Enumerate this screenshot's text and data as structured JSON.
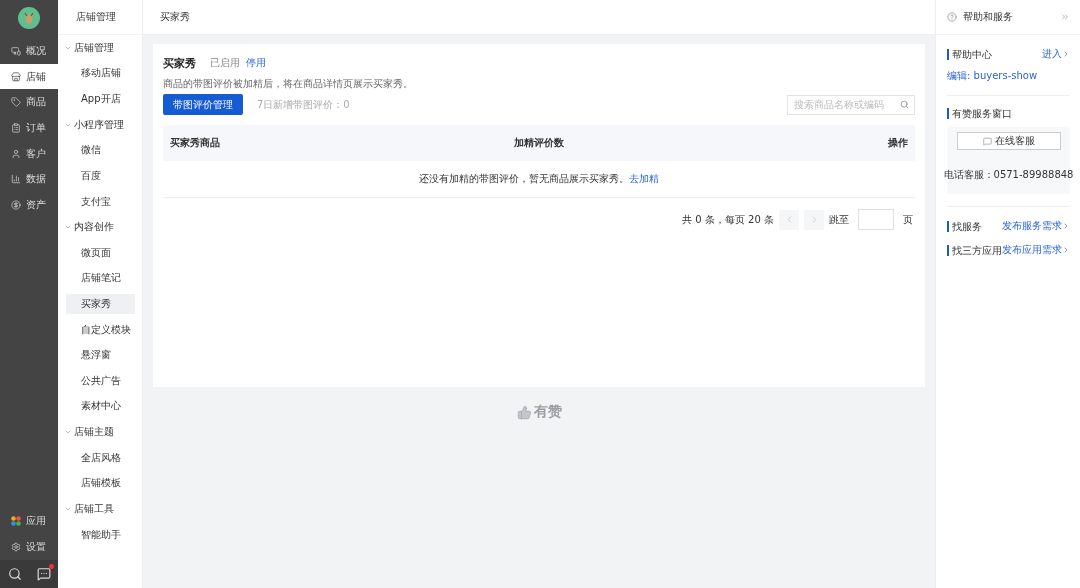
{
  "nav": {
    "top": [
      {
        "label": "概况",
        "selected": false
      },
      {
        "label": "店铺",
        "selected": true
      },
      {
        "label": "商品",
        "selected": false
      },
      {
        "label": "订单",
        "selected": false
      },
      {
        "label": "客户",
        "selected": false
      },
      {
        "label": "数据",
        "selected": false
      },
      {
        "label": "资产",
        "selected": false
      }
    ],
    "bottom": [
      {
        "label": "应用",
        "selected": false
      },
      {
        "label": "设置",
        "selected": false
      }
    ],
    "chat_unread": true
  },
  "sidebar": {
    "title": "店铺管理",
    "groups": [
      {
        "label": "店铺管理",
        "expanded": true,
        "children": [
          {
            "label": "移动店铺",
            "selected": false
          },
          {
            "label": "App开店",
            "selected": false
          }
        ]
      },
      {
        "label": "小程序管理",
        "expanded": true,
        "children": [
          {
            "label": "微信",
            "selected": false
          },
          {
            "label": "百度",
            "selected": false
          },
          {
            "label": "支付宝",
            "selected": false
          }
        ]
      },
      {
        "label": "内容创作",
        "expanded": true,
        "children": [
          {
            "label": "微页面",
            "selected": false
          },
          {
            "label": "店铺笔记",
            "selected": false
          },
          {
            "label": "买家秀",
            "selected": true
          },
          {
            "label": "自定义模块",
            "selected": false
          },
          {
            "label": "悬浮窗",
            "selected": false
          },
          {
            "label": "公共广告",
            "selected": false
          },
          {
            "label": "素材中心",
            "selected": false
          }
        ]
      },
      {
        "label": "店铺主题",
        "expanded": true,
        "children": [
          {
            "label": "全店风格",
            "selected": false
          },
          {
            "label": "店铺模板",
            "selected": false
          }
        ]
      },
      {
        "label": "店铺工具",
        "expanded": true,
        "children": [
          {
            "label": "智能助手",
            "selected": false
          }
        ]
      }
    ]
  },
  "breadcrumb": "买家秀",
  "card": {
    "title": "买家秀",
    "status": "已启用",
    "toggle_link": "停用",
    "description": "商品的带图评价被加精后，将在商品详情页展示买家秀。",
    "primary_button": "带图评价管理",
    "stat": "7日新增带图评价：0",
    "search": {
      "placeholder": "搜索商品名称或编码"
    },
    "table": {
      "columns": [
        "买家秀商品",
        "加精评价数",
        "操作"
      ],
      "empty_text": "还没有加精的带图评价，暂无商品展示买家秀。",
      "empty_link": "去加精"
    },
    "pagination": {
      "summary": "共 0 条，每页 20 条",
      "prev_disabled": true,
      "next_disabled": true,
      "jump_label": "跳至",
      "page_unit": "页"
    }
  },
  "footer_brand": "有赞",
  "help": {
    "title": "帮助和服务",
    "sections": [
      {
        "kind": "help",
        "title": "帮助中心",
        "link": "进入",
        "note": "编辑: buyers-show"
      },
      {
        "kind": "service",
        "title": "有赞服务窗口",
        "button": "在线客服",
        "phone": "电话客服：0571-89988848"
      },
      {
        "kind": "links",
        "rows": [
          {
            "title": "找服务",
            "link": "发布服务需求"
          },
          {
            "title": "找三方应用",
            "link": "发布应用需求"
          }
        ]
      }
    ]
  }
}
